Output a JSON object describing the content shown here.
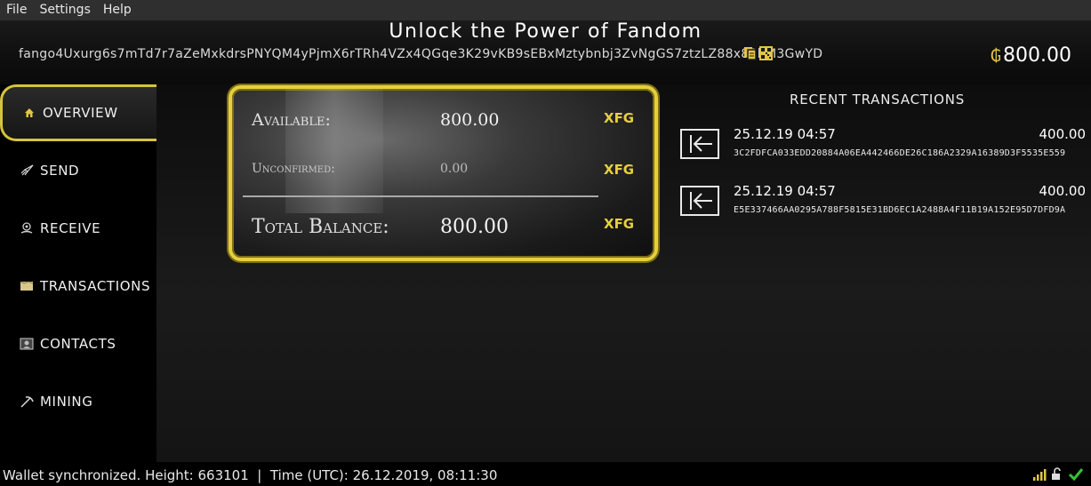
{
  "menubar": {
    "items": [
      "File",
      "Settings",
      "Help"
    ]
  },
  "header": {
    "title": "Unlock the Power of Fandom",
    "address": "fango4Uxurg6s7mTd7r7aZeMxkdrsPNYQM4yPjmX6rTRh4VZx4QGqe3K29vKB9sEBxMztybnbj3ZvNgGS7ztzLZ88x83hM3GwYD",
    "currency_symbol": "₲",
    "balance": "800.00"
  },
  "sidebar": {
    "items": [
      {
        "label": "OVERVIEW",
        "icon": "home-icon"
      },
      {
        "label": "SEND",
        "icon": "rocket-icon"
      },
      {
        "label": "RECEIVE",
        "icon": "receive-icon"
      },
      {
        "label": "TRANSACTIONS",
        "icon": "map-icon"
      },
      {
        "label": "CONTACTS",
        "icon": "contacts-icon"
      },
      {
        "label": "MINING",
        "icon": "pickaxe-icon"
      }
    ]
  },
  "balance_card": {
    "available_label": "Available:",
    "available_value": "800.00",
    "unconfirmed_label": "Unconfirmed:",
    "unconfirmed_value": "0.00",
    "total_label": "Total Balance:",
    "total_value": "800.00",
    "currency": "XFG"
  },
  "recent": {
    "title": "RECENT TRANSACTIONS",
    "transactions": [
      {
        "date": "25.12.19 04:57",
        "amount": "400.00",
        "hash": "3C2FDFCA033EDD20884A06EA442466DE26C186A2329A16389D3F5535E559"
      },
      {
        "date": "25.12.19 04:57",
        "amount": "400.00",
        "hash": "E5E337466AA0295A788F5815E31BD6EC1A2488A4F11B19A152E95D7DFD9A"
      }
    ]
  },
  "status": {
    "text": "Wallet synchronized. Height: 663101  |  Time (UTC): 26.12.2019, 08:11:30"
  },
  "colors": {
    "accent": "#e6cf3e",
    "background": "#000000"
  }
}
